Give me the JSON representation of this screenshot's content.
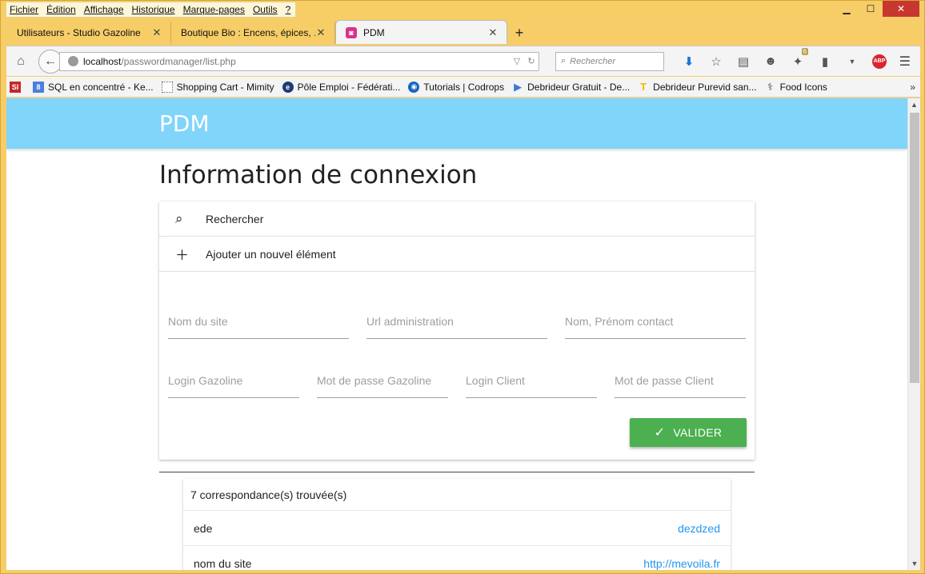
{
  "menu": [
    "Fichier",
    "Édition",
    "Affichage",
    "Historique",
    "Marque-pages",
    "Outils",
    "?"
  ],
  "window_controls": {
    "minimize": "▁",
    "maximize": "☐",
    "close": "✕"
  },
  "tabs": [
    {
      "title": "Utilisateurs - Studio Gazoline",
      "active": false
    },
    {
      "title": "Boutique Bio : Encens, épices, ...",
      "active": false
    },
    {
      "title": "PDM",
      "active": true
    }
  ],
  "newtab_label": "+",
  "urlbar": {
    "host": "localhost",
    "path": "/passwordmanager/list.php"
  },
  "search": {
    "placeholder": "Rechercher"
  },
  "downloads_badge": "6",
  "adblock_label": "ABP",
  "bookmarks": [
    {
      "label": "",
      "icon": "si-icon",
      "color": "#c62828",
      "glyph": "SI"
    },
    {
      "label": "SQL en concentré - Ke...",
      "icon": "google-icon",
      "color": "#4a7fdc",
      "glyph": "8"
    },
    {
      "label": "Shopping Cart - Mimity",
      "icon": "page-icon",
      "color": "#ffffff",
      "glyph": ""
    },
    {
      "label": "Pôle Emploi - Fédérati...",
      "icon": "pole-emploi-icon",
      "color": "#1f3a7a",
      "glyph": "e"
    },
    {
      "label": "Tutorials | Codrops",
      "icon": "codrops-icon",
      "color": "#1565c0",
      "glyph": "◉"
    },
    {
      "label": "Debrideur Gratuit - De...",
      "icon": "play-icon",
      "color": "#3a7bd5",
      "glyph": "▶"
    },
    {
      "label": "Debrideur Purevid san...",
      "icon": "bolt-icon",
      "color": "#f5b800",
      "glyph": "T"
    },
    {
      "label": "Food Icons",
      "icon": "food-icon",
      "color": "#555555",
      "glyph": "⚕"
    }
  ],
  "bookmarks_more": "»",
  "app": {
    "brand": "PDM",
    "page_title": "Information de connexion",
    "search_label": "Rechercher",
    "add_label": "Ajouter un nouvel élément",
    "fields_row1": [
      "Nom du site",
      "Url administration",
      "Nom, Prénom contact"
    ],
    "fields_row2": [
      "Login Gazoline",
      "Mot de passe Gazoline",
      "Login Client",
      "Mot de passe Client"
    ],
    "submit_label": "VALIDER"
  },
  "results": {
    "count_label": "7 correspondance(s) trouvée(s)",
    "rows": [
      {
        "name": "ede",
        "link": "dezdzed"
      },
      {
        "name": "nom du site",
        "link": "http://mevoila.fr"
      }
    ]
  },
  "colors": {
    "header": "#81d4fa",
    "accent_button": "#4caf50",
    "link": "#2196f3"
  }
}
